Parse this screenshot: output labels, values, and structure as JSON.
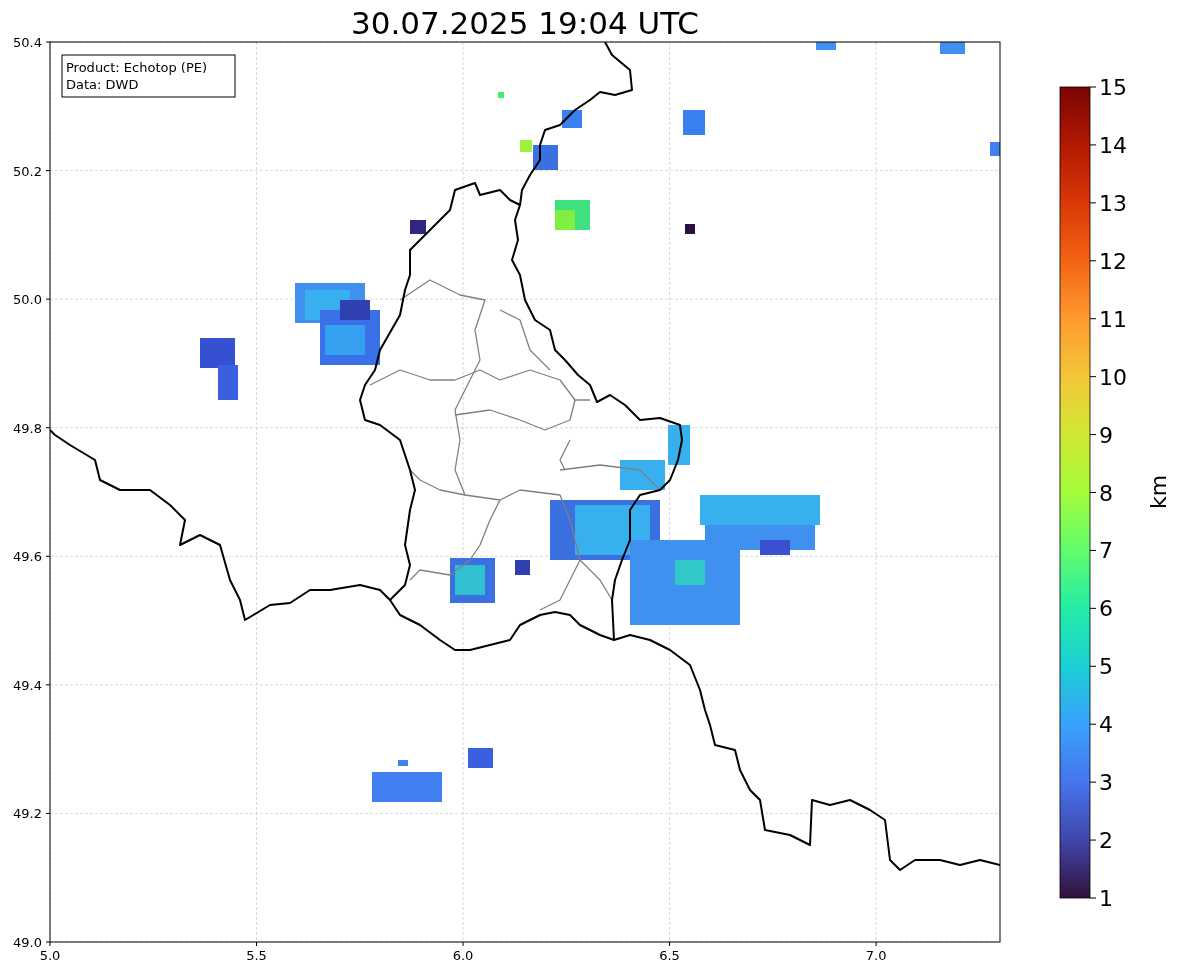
{
  "title": "30.07.2025 19:04 UTC",
  "legend": [
    "Product: Echotop (PE)",
    "Data: DWD"
  ],
  "x_ticks": [
    "5.0",
    "5.5",
    "6.0",
    "6.5",
    "7.0"
  ],
  "y_ticks": [
    "50.4",
    "50.2",
    "50.0",
    "49.8",
    "49.6",
    "49.4",
    "49.2",
    "49.0"
  ],
  "colorbar": {
    "label": "km",
    "ticks": [
      "15",
      "14",
      "13",
      "12",
      "11",
      "10",
      "9",
      "8",
      "7",
      "6",
      "5",
      "4",
      "3",
      "2",
      "1"
    ]
  }
}
